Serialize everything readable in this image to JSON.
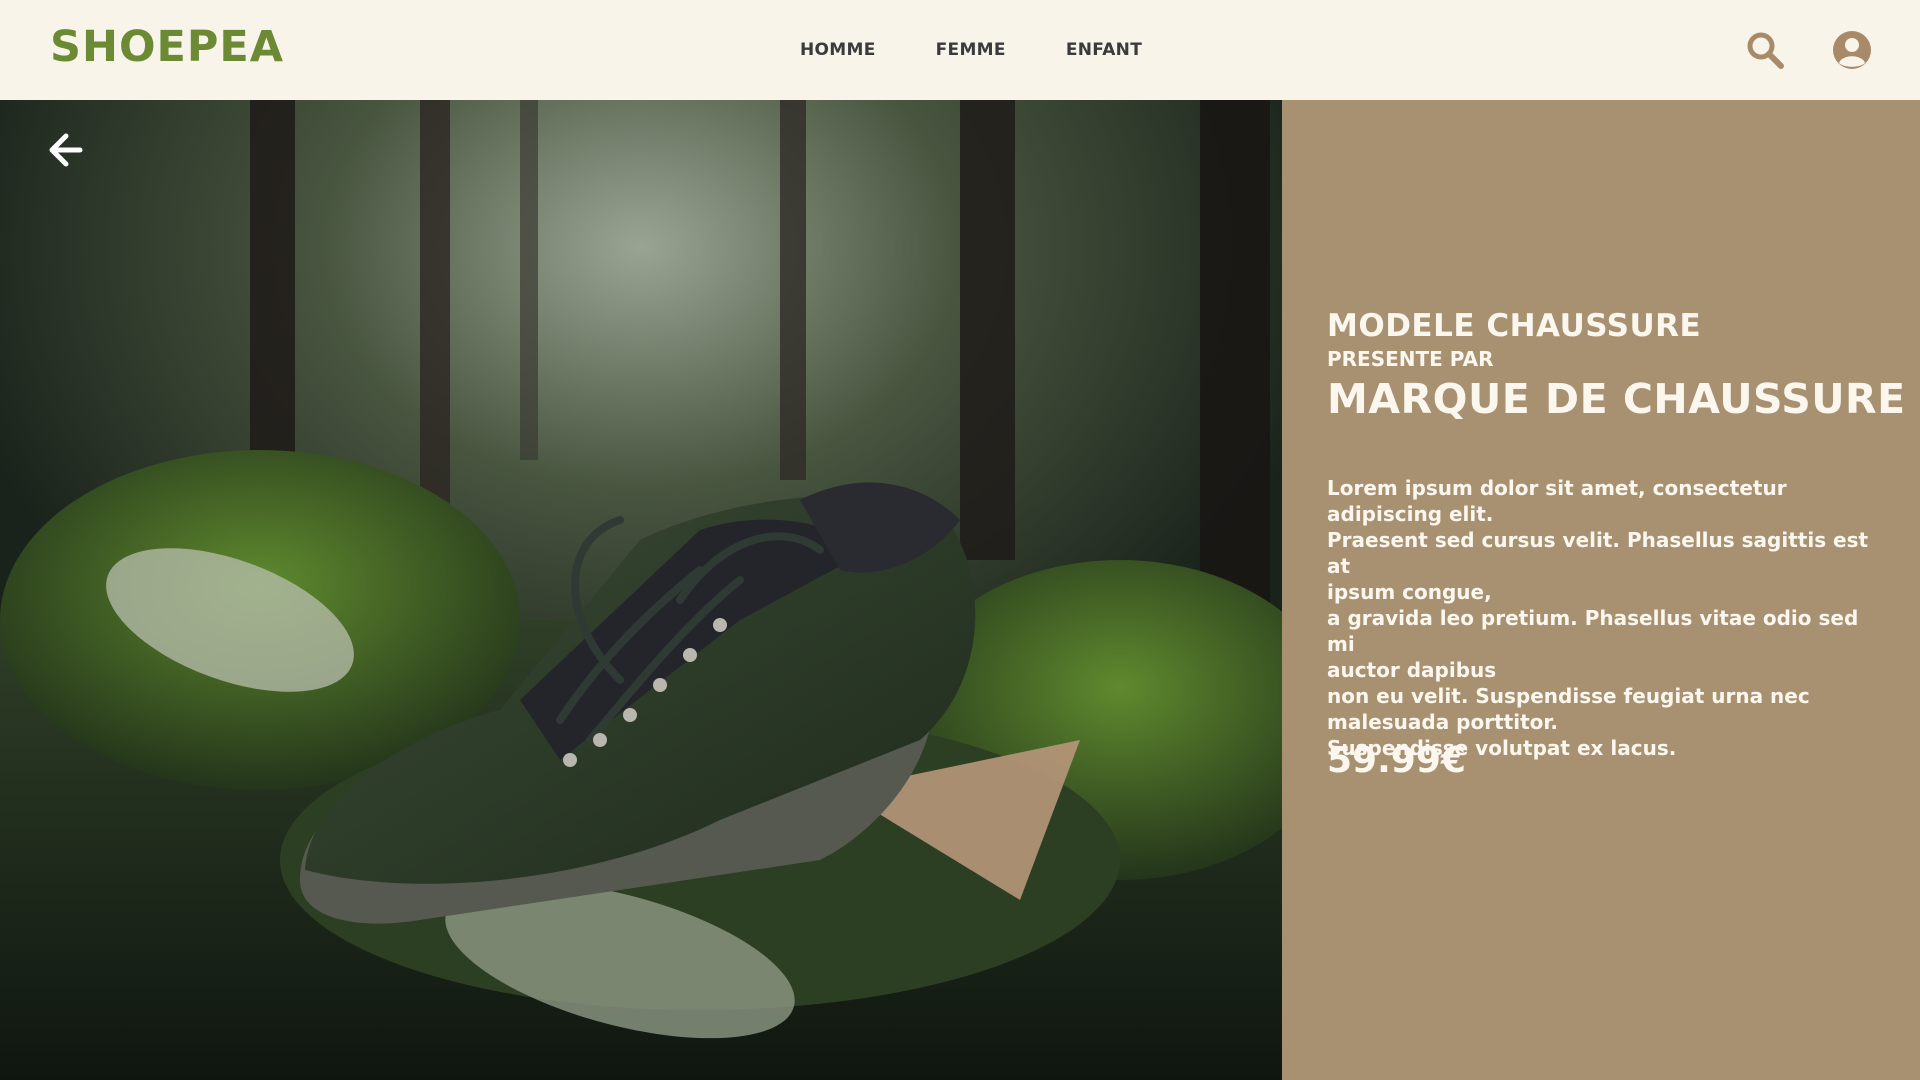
{
  "header": {
    "logo": "SHOEPEA",
    "nav": [
      {
        "label": "HOMME"
      },
      {
        "label": "FEMME"
      },
      {
        "label": "ENFANT"
      }
    ],
    "icons": {
      "search": "search-icon",
      "account": "user-circle-icon"
    }
  },
  "hero": {
    "back_icon": "arrow-left-icon",
    "image": "shoe-in-forest-photo"
  },
  "product": {
    "model": "MODELE CHAUSSURE",
    "presented_by": "PRESENTE PAR",
    "brand": "MARQUE DE CHAUSSURE",
    "description_lines": [
      "Lorem ipsum dolor sit amet, consectetur",
      "adipiscing elit.",
      "Praesent sed cursus velit. Phasellus sagittis est at",
      "ipsum congue,",
      "a gravida leo pretium. Phasellus vitae odio sed mi",
      "auctor dapibus",
      "non eu velit. Suspendisse feugiat urna nec",
      "malesuada porttitor.",
      "Suspendisse volutpat ex lacus."
    ],
    "price": "59.99€"
  },
  "colors": {
    "background": "#f8f4ea",
    "brand_green": "#6b8a33",
    "panel": "#a89171",
    "icon": "#a88a68"
  }
}
